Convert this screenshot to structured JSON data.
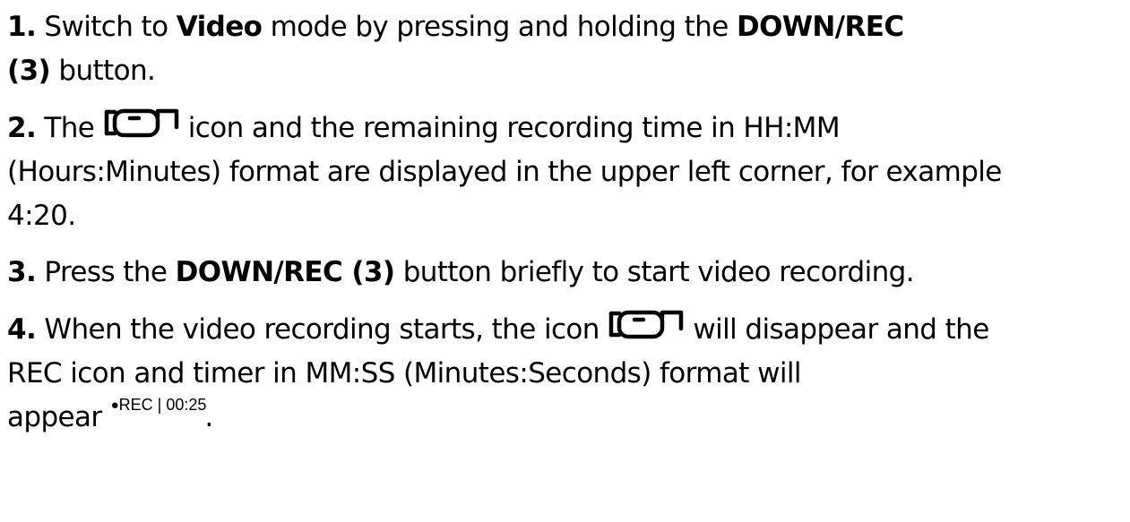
{
  "steps": [
    {
      "num": "1.",
      "parts": {
        "t1": " Switch to ",
        "b1": "Video",
        "t2": " mode by pressing and holding the ",
        "b2": "DOWN/REC",
        "b3": "(3)",
        "t3": " button."
      }
    },
    {
      "num": "2.",
      "parts": {
        "t1": " The ",
        "icon": "video-camera-icon",
        "t2": " icon and the remaining recording time in HH:MM",
        "t3": "(Hours:Minutes) format are displayed in the upper left corner, for example",
        "t4": "4:20."
      }
    },
    {
      "num": "3.",
      "parts": {
        "t1": " Press the ",
        "b1": "DOWN/REC (3)",
        "t2": " button briefly to start video recording."
      }
    },
    {
      "num": "4.",
      "parts": {
        "t1": " When the video recording starts, the icon ",
        "icon": "video-camera-icon",
        "t2": " will disappear and the",
        "t3": "REC icon and timer in MM:SS (Minutes:Seconds) format will",
        "t4": "appear",
        "rec_dot": "●",
        "rec_text": "REC | 00:25",
        "t5": "."
      }
    }
  ]
}
